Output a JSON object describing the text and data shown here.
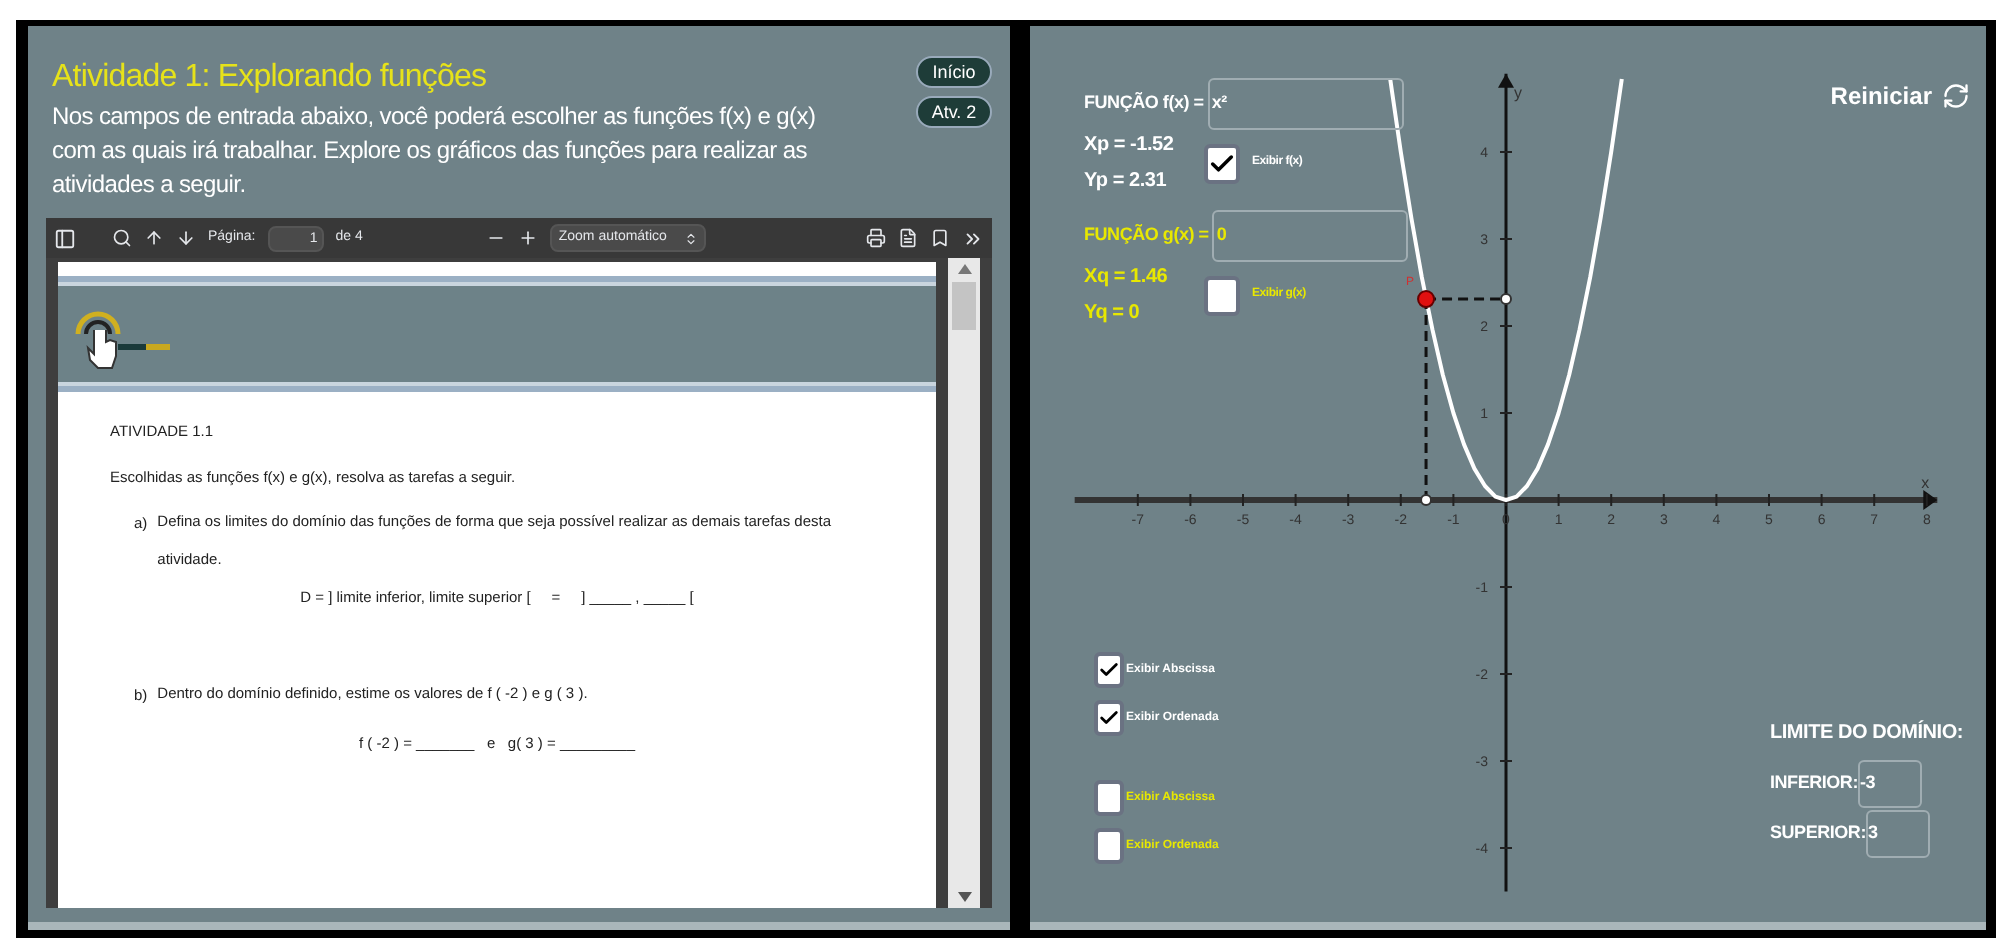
{
  "left_panel": {
    "title": "Atividade 1: Explorando funções",
    "description": "Nos campos de entrada abaixo, você poderá escolher as funções f(x) e g(x) com as quais irá trabalhar. Explore os gráficos das funções para realizar as atividades a seguir.",
    "nav_buttons": [
      "Início",
      "Atv. 2"
    ],
    "pdf_viewer": {
      "toolbar": {
        "page_label": "Página:",
        "page_value": "1",
        "page_count": "de 4",
        "zoom": "Zoom automático"
      },
      "document": {
        "heading": "ATIVIDADE 1.1",
        "intro": "Escolhidas as funções f(x) e g(x), resolva as tarefas a seguir.",
        "tasks": [
          {
            "marker": "a)",
            "text": "Defina os limites do domínio das funções de forma que seja possível realizar as demais tarefas desta atividade.",
            "formula": "D = ] limite inferior, limite superior [     =     ] _____ , _____ ["
          },
          {
            "marker": "b)",
            "text": "Dentro do domínio definido, estime os valores de f ( -2 ) e  g ( 3 ).",
            "formula": "f ( -2 ) = _______   e   g( 3 ) = _________"
          }
        ]
      }
    }
  },
  "right_panel": {
    "reset_label": "Reiniciar",
    "functions": [
      {
        "label": "FUNÇÃO f(x) =",
        "value": "x²",
        "coords": [
          "Xp = -1.52",
          "Yp = 2.31"
        ],
        "toggle": {
          "label": "Exibir f(x)",
          "checked": true
        },
        "color": "#ffffff"
      },
      {
        "label": "FUNÇÃO g(x) =",
        "value": "0",
        "coords": [
          "Xq = 1.46",
          "Yq = 0"
        ],
        "toggle": {
          "label": "Exibir g(x)",
          "checked": false
        },
        "color": "#e8e800"
      }
    ],
    "option_groups": [
      {
        "color": "#ffffff",
        "options": [
          {
            "label": "Exibir Abscissa",
            "checked": true
          },
          {
            "label": "Exibir Ordenada",
            "checked": true
          }
        ]
      },
      {
        "color": "#e8e800",
        "options": [
          {
            "label": "Exibir Abscissa",
            "checked": false
          },
          {
            "label": "Exibir Ordenada",
            "checked": false
          }
        ]
      }
    ],
    "domain": {
      "title": "LIMITE DO DOMÍNIO:",
      "fields": [
        {
          "label": "INFERIOR:",
          "value": "-3"
        },
        {
          "label": "SUPERIOR:",
          "value": "3"
        }
      ]
    },
    "graph": {
      "chart_data": {
        "type": "line",
        "xlabel": "x",
        "ylabel": "y",
        "x": [
          -2.2,
          -2,
          -1.8,
          -1.6,
          -1.4,
          -1.2,
          -1,
          -0.8,
          -0.6,
          -0.4,
          -0.2,
          0,
          0.2,
          0.4,
          0.6,
          0.8,
          1,
          1.2,
          1.4,
          1.6,
          1.8,
          2,
          2.2
        ],
        "series": [
          {
            "color": "#ffffff",
            "values": [
              4.84,
              4,
              3.24,
              2.56,
              1.96,
              1.44,
              1,
              0.64,
              0.36,
              0.16,
              0.04,
              0,
              0.04,
              0.16,
              0.36,
              0.64,
              1,
              1.44,
              1.96,
              2.56,
              3.24,
              4,
              4.84
            ]
          }
        ],
        "xlim": [
          -8.2,
          8.2
        ],
        "ylim": [
          -4.5,
          4.9
        ],
        "xticks": [
          -7,
          -6,
          -5,
          -4,
          -3,
          -2,
          -1,
          0,
          1,
          2,
          3,
          4,
          5,
          6,
          7,
          8
        ],
        "yticks": [
          -4,
          -3,
          -2,
          -1,
          1,
          2,
          3,
          4
        ],
        "annotations": [
          {
            "text": "P",
            "x": -1.52,
            "y": 2.31
          }
        ]
      }
    }
  }
}
